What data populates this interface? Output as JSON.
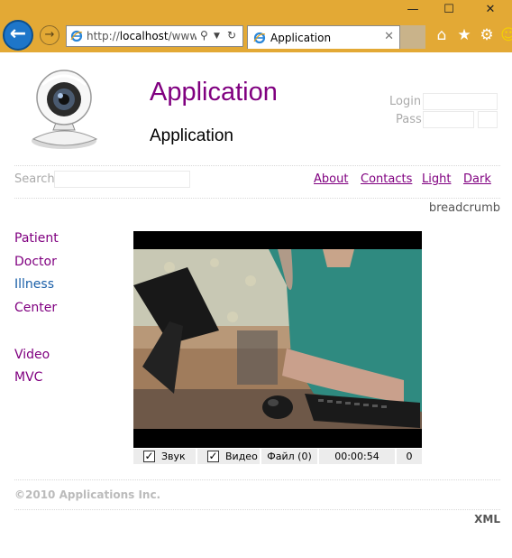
{
  "browser": {
    "url_prefix": "http://",
    "url_host": "localhost",
    "url_rest": "/www/...",
    "tab_title": "Application",
    "window_buttons": [
      "—",
      "☐",
      "✕"
    ]
  },
  "header": {
    "title": "Application",
    "subtitle": "Application",
    "login_label": "Login",
    "pass_label": "Pass",
    "login_value": "",
    "pass_value": ""
  },
  "nav": {
    "search_label": "Search",
    "search_value": "",
    "links": [
      "About",
      "Contacts",
      "Light",
      "Dark"
    ]
  },
  "breadcrumb": "breadcrumb",
  "sidebar": {
    "items": [
      {
        "label": "Patient"
      },
      {
        "label": "Doctor"
      },
      {
        "label": "Illness"
      },
      {
        "label": "Center"
      },
      {
        "label": "Video"
      },
      {
        "label": "MVC"
      }
    ]
  },
  "video": {
    "sound_label": "Звук",
    "video_label": "Видео",
    "file_label": "Файл (0)",
    "time": "00:00:54",
    "count": "0",
    "sound_checked": true,
    "video_checked": true
  },
  "footer": {
    "copyright": "©2010 Applications Inc.",
    "xml": "XML"
  },
  "colors": {
    "chrome": "#e3a935",
    "accent": "#800080",
    "link_blue": "#1a5fa8"
  }
}
